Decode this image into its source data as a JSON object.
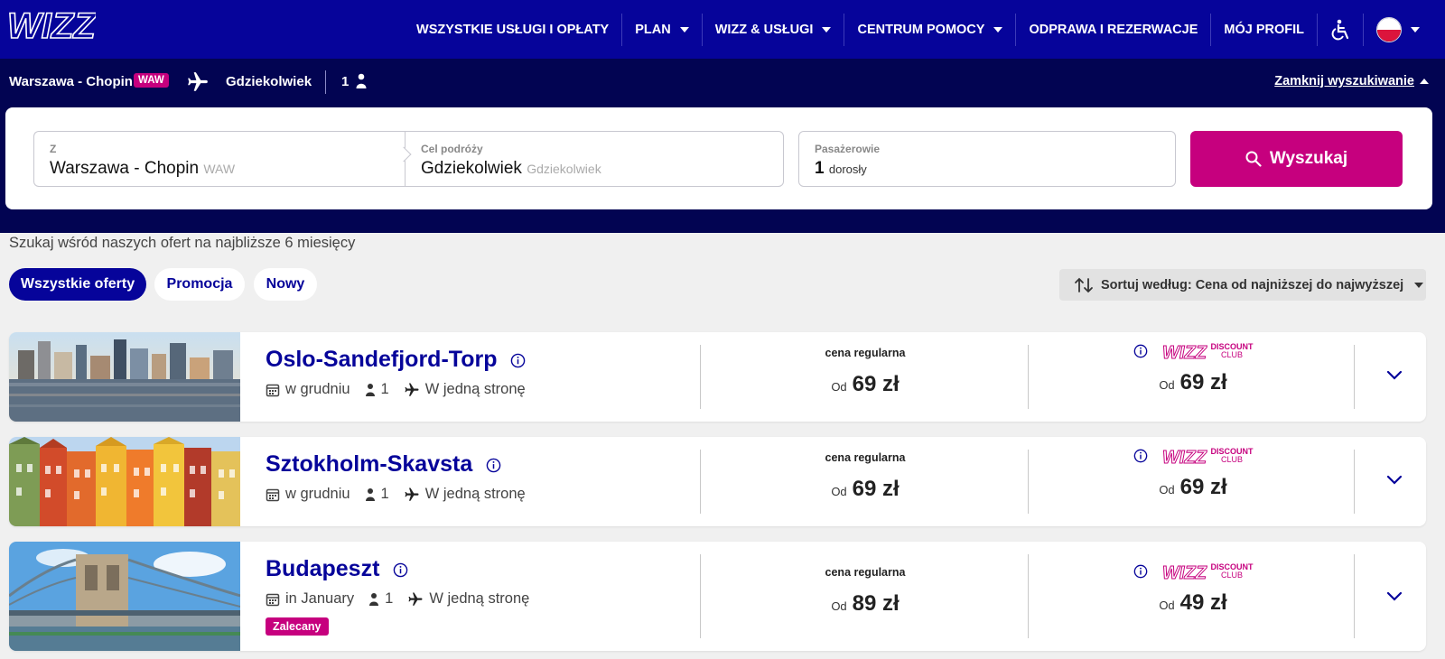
{
  "header": {
    "logo_text": "WIZZ",
    "nav": [
      {
        "label": "WSZYSTKIE USŁUGI I OPŁATY",
        "has_caret": false
      },
      {
        "label": "PLAN",
        "has_caret": true
      },
      {
        "label": "WIZZ & USŁUGI",
        "has_caret": true
      },
      {
        "label": "CENTRUM POMOCY",
        "has_caret": true
      },
      {
        "label": "ODPRAWA I REZERWACJE",
        "has_caret": false
      },
      {
        "label": "MÓJ PROFIL",
        "has_caret": false
      }
    ],
    "accessibility_icon": "wheelchair-icon",
    "language_flag": "poland-flag"
  },
  "summary": {
    "from": "Warszawa - Chopin",
    "from_code": "WAW",
    "to": "Gdziekolwiek",
    "passengers": "1",
    "close_label": "Zamknij wyszukiwanie"
  },
  "search": {
    "from_label": "Z",
    "from_value": "Warszawa - Chopin",
    "from_hint": "WAW",
    "to_label": "Cel podróży",
    "to_value": "Gdziekolwiek",
    "to_hint": "Gdziekolwiek",
    "pax_label": "Pasażerowie",
    "pax_count": "1",
    "pax_type": "dorosły",
    "button_label": "Wyszukaj"
  },
  "hint_text": "Szukaj wśród naszych ofert na najbliższe 6 miesięcy",
  "filters": {
    "all": "Wszystkie oferty",
    "promo": "Promocja",
    "new": "Nowy"
  },
  "sort_label": "Sortuj według: Cena od najniższej do najwyższej",
  "discount_club": {
    "line1": "DISCOUNT",
    "line2": "CLUB",
    "brand": "WIZZ"
  },
  "offers": [
    {
      "destination": "Oslo-Sandefjord-Torp",
      "when": "w grudniu",
      "passengers": "1",
      "trip_type": "W jedną stronę",
      "regular_label": "cena regularna",
      "od": "Od",
      "regular_price": "69 zł",
      "club_price": "69 zł",
      "badge": ""
    },
    {
      "destination": "Sztokholm-Skavsta",
      "when": "w grudniu",
      "passengers": "1",
      "trip_type": "W jedną stronę",
      "regular_label": "cena regularna",
      "od": "Od",
      "regular_price": "69 zł",
      "club_price": "69 zł",
      "badge": ""
    },
    {
      "destination": "Budapeszt",
      "when": "in January",
      "passengers": "1",
      "trip_type": "W jedną stronę",
      "regular_label": "cena regularna",
      "od": "Od",
      "regular_price": "89 zł",
      "club_price": "49 zł",
      "badge": "Zalecany"
    }
  ],
  "colors": {
    "brand_navy": "#06049a",
    "dark_navy": "#020452",
    "magenta": "#c6007e"
  }
}
